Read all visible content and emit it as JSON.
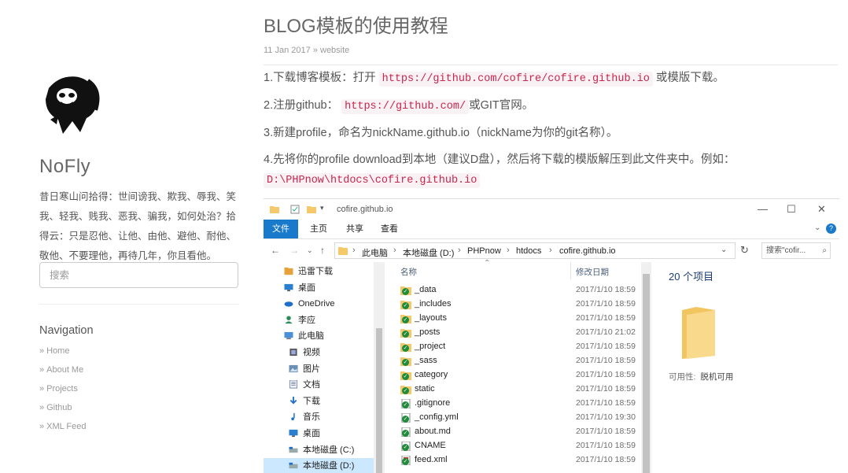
{
  "sidebar": {
    "site_name": "NoFly",
    "description": "昔日寒山问拾得：世间谤我、欺我、辱我、笑我、轻我、贱我、恶我、骗我，如何处治？拾得云：只是忍他、让他、由他、避他、耐他、敬他、不要理他，再待几年，你且看他。",
    "search_placeholder": "搜索",
    "nav_title": "Navigation",
    "nav_items": [
      "Home",
      "About Me",
      "Projects",
      "Github",
      "XML Feed"
    ],
    "nav_arrow": "»"
  },
  "post": {
    "title": "BLOG模板的使用教程",
    "date": "11 Jan 2017",
    "meta_sep": "»",
    "category": "website",
    "p1_prefix": "1.下载博客模板：打开",
    "p1_code": "https://github.com/cofire/cofire.github.io",
    "p1_suffix": "或模版下载。",
    "p2_prefix": "2.注册github：",
    "p2_code": "https://github.com/",
    "p2_suffix": "或GIT官网。",
    "p3": "3.新建profile，命名为nickName.github.io（nickName为你的git名称）。",
    "p4_prefix": "4.先将你的profile download到本地（建议D盘），然后将下载的模版解压到此文件夹中。例如：",
    "p4_code": "D:\\PHPnow\\htdocs\\cofire.github.io"
  },
  "explorer": {
    "window_title": "cofire.github.io",
    "window_buttons": [
      "—",
      "☐",
      "✕"
    ],
    "ribbon_tabs": [
      "文件",
      "主页",
      "共享",
      "查看"
    ],
    "breadcrumb": [
      "此电脑",
      "本地磁盘 (D:)",
      "PHPnow",
      "htdocs",
      "cofire.github.io"
    ],
    "search_placeholder": "搜索\"cofir...",
    "nav_pane": [
      {
        "label": "迅雷下载",
        "icon": "thunder-folder-icon",
        "indent": false
      },
      {
        "label": "桌面",
        "icon": "desktop-icon",
        "indent": false
      },
      {
        "label": "OneDrive",
        "icon": "onedrive-icon",
        "indent": false
      },
      {
        "label": "李应",
        "icon": "user-icon",
        "indent": false
      },
      {
        "label": "此电脑",
        "icon": "computer-icon",
        "indent": false
      },
      {
        "label": "视频",
        "icon": "video-folder-icon",
        "indent": true
      },
      {
        "label": "图片",
        "icon": "pictures-folder-icon",
        "indent": true
      },
      {
        "label": "文档",
        "icon": "documents-folder-icon",
        "indent": true
      },
      {
        "label": "下载",
        "icon": "download-arrow-icon",
        "indent": true
      },
      {
        "label": "音乐",
        "icon": "music-note-icon",
        "indent": true
      },
      {
        "label": "桌面",
        "icon": "desktop-icon",
        "indent": true
      },
      {
        "label": "本地磁盘 (C:)",
        "icon": "drive-icon",
        "indent": true
      },
      {
        "label": "本地磁盘 (D:)",
        "icon": "drive-icon",
        "indent": true,
        "selected": true
      }
    ],
    "columns": {
      "name": "名称",
      "date": "修改日期"
    },
    "files": [
      {
        "name": "_data",
        "date": "2017/1/10 18:59",
        "kind": "folder"
      },
      {
        "name": "_includes",
        "date": "2017/1/10 18:59",
        "kind": "folder"
      },
      {
        "name": "_layouts",
        "date": "2017/1/10 18:59",
        "kind": "folder"
      },
      {
        "name": "_posts",
        "date": "2017/1/10 21:02",
        "kind": "folder"
      },
      {
        "name": "_project",
        "date": "2017/1/10 18:59",
        "kind": "folder"
      },
      {
        "name": "_sass",
        "date": "2017/1/10 18:59",
        "kind": "folder"
      },
      {
        "name": "category",
        "date": "2017/1/10 18:59",
        "kind": "folder"
      },
      {
        "name": "static",
        "date": "2017/1/10 18:59",
        "kind": "folder"
      },
      {
        "name": ".gitignore",
        "date": "2017/1/10 18:59",
        "kind": "file"
      },
      {
        "name": "_config.yml",
        "date": "2017/1/10 19:30",
        "kind": "file"
      },
      {
        "name": "about.md",
        "date": "2017/1/10 18:59",
        "kind": "file"
      },
      {
        "name": "CNAME",
        "date": "2017/1/10 18:59",
        "kind": "file"
      },
      {
        "name": "feed.xml",
        "date": "2017/1/10 18:59",
        "kind": "xml"
      }
    ],
    "item_count": "20 个项目",
    "availability_key": "可用性:",
    "availability_value": "脱机可用",
    "colors": {
      "accent": "#1979ca",
      "folder": "#f5c86a",
      "sync_green": "#1e8c3a",
      "code_red": "#c7254e"
    }
  }
}
